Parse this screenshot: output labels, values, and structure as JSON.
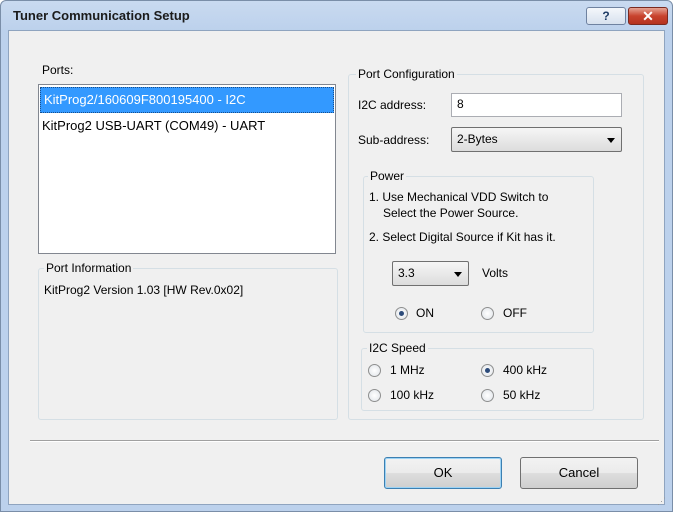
{
  "window": {
    "title": "Tuner Communication Setup",
    "help_label": "?",
    "close_label": "✕"
  },
  "ports": {
    "label": "Ports:",
    "items": [
      {
        "label": "KitProg2/160609F800195400 - I2C",
        "selected": true
      },
      {
        "label": "KitProg2 USB-UART (COM49) - UART",
        "selected": false
      }
    ]
  },
  "port_information": {
    "label": "Port Information",
    "text": "KitProg2 Version 1.03 [HW Rev.0x02]"
  },
  "port_configuration": {
    "label": "Port Configuration",
    "i2c_address_label": "I2C address:",
    "i2c_address_value": "8",
    "sub_address_label": "Sub-address:",
    "sub_address_value": "2-Bytes"
  },
  "power": {
    "label": "Power",
    "instruction_1_line1": "1. Use Mechanical VDD Switch to",
    "instruction_1_line2": "Select the Power Source.",
    "instruction_2": "2. Select Digital Source if Kit has it.",
    "voltage_value": "3.3",
    "volts_label": "Volts",
    "on_label": "ON",
    "off_label": "OFF",
    "selected": "ON"
  },
  "i2c_speed": {
    "label": "I2C Speed",
    "options": [
      "1 MHz",
      "400 kHz",
      "100 kHz",
      "50 kHz"
    ],
    "selected": "400 kHz"
  },
  "buttons": {
    "ok_label": "OK",
    "cancel_label": "Cancel"
  }
}
